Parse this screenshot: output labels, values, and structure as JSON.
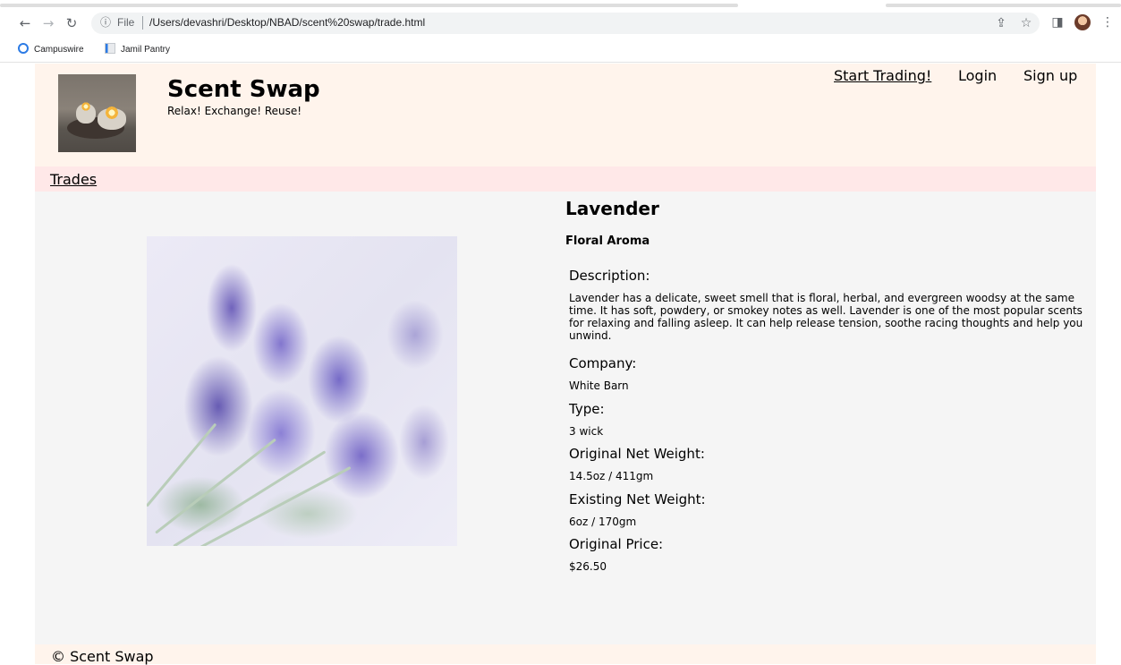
{
  "browser": {
    "url_scheme_label": "File",
    "url": "/Users/devashri/Desktop/NBAD/scent%20swap/trade.html",
    "bookmarks": [
      {
        "label": "Campuswire"
      },
      {
        "label": "Jamil Pantry"
      }
    ],
    "icons": {
      "back": "arrow-left-icon",
      "forward": "arrow-right-icon",
      "reload": "reload-icon",
      "info": "info-icon",
      "share": "share-icon",
      "bookmark_star": "star-icon",
      "side_panel": "side-panel-icon",
      "profile": "profile-avatar",
      "menu": "kebab-menu-icon"
    }
  },
  "header": {
    "title": "Scent Swap",
    "tagline": "Relax! Exchange! Reuse!",
    "nav": {
      "start_trading": "Start Trading!",
      "login": "Login",
      "signup": "Sign up"
    }
  },
  "subnav": {
    "trades": "Trades"
  },
  "product": {
    "name": "Lavender",
    "category": "Floral Aroma",
    "description_label": "Description:",
    "description": "Lavender has a delicate, sweet smell that is floral, herbal, and evergreen woodsy at the same time. It has soft, powdery, or smokey notes as well. Lavender is one of the most popular scents for relaxing and falling asleep. It can help release tension, soothe racing thoughts and help you unwind.",
    "company_label": "Company:",
    "company": "White Barn",
    "type_label": "Type:",
    "type": "3 wick",
    "original_weight_label": "Original Net Weight:",
    "original_weight": "14.5oz / 411gm",
    "existing_weight_label": "Existing Net Weight:",
    "existing_weight": "6oz / 170gm",
    "price_label": "Original Price:",
    "price": "$26.50"
  },
  "footer": {
    "text": "© Scent Swap"
  },
  "colors": {
    "header_bg": "#fff4ec",
    "subnav_bg": "#ffe8e8",
    "content_bg": "#f5f5f5"
  }
}
